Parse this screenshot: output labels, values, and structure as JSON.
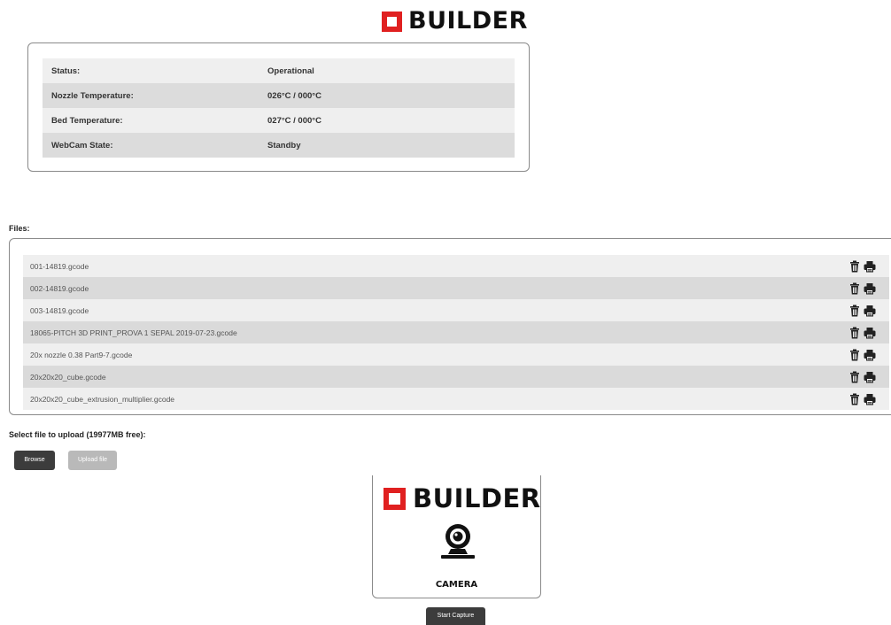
{
  "brand": {
    "logo_text": "BUILDER",
    "accent_color": "#e02020"
  },
  "status": {
    "rows": [
      {
        "label": "Status:",
        "value": "Operational"
      },
      {
        "label": "Nozzle Temperature:",
        "value": "026°C / 000°C"
      },
      {
        "label": "Bed Temperature:",
        "value": "027°C / 000°C"
      },
      {
        "label": "WebCam State:",
        "value": "Standby"
      }
    ]
  },
  "files": {
    "title": "Files:",
    "items": [
      {
        "name": "001-14819.gcode"
      },
      {
        "name": "002-14819.gcode"
      },
      {
        "name": "003-14819.gcode"
      },
      {
        "name": "18065-PITCH 3D PRINT_PROVA 1 SEPAL 2019-07-23.gcode"
      },
      {
        "name": "20x nozzle 0.38 Part9-7.gcode"
      },
      {
        "name": "20x20x20_cube.gcode"
      },
      {
        "name": "20x20x20_cube_extrusion_multiplier.gcode"
      }
    ],
    "row_icons": [
      "trash-icon",
      "printer-icon"
    ]
  },
  "upload": {
    "label": "Select file to upload (19977MB free):",
    "browse_label": "Browse",
    "upload_label": "Upload file"
  },
  "camera": {
    "logo_text": "BUILDER",
    "label": "CAMERA",
    "icon": "webcam-icon",
    "start_label": "Start Capture"
  }
}
